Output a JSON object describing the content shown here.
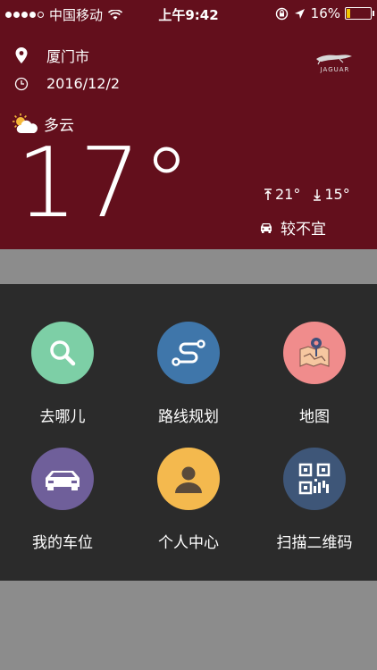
{
  "status": {
    "carrier": "中国移动",
    "time": "上午9:42",
    "battery": "16%",
    "battery_level": 0.16,
    "battery_color": "#f2c700"
  },
  "weather": {
    "city": "厦门市",
    "date": "2016/12/2",
    "brand": "JAGUAR",
    "condition": "多云",
    "temperature": "17°",
    "high": "21°",
    "low": "15°",
    "driving": "较不宜",
    "background": "#630f1c"
  },
  "menu": {
    "items": [
      {
        "label": "去哪儿",
        "icon": "search-icon",
        "color": "#7dcfa6"
      },
      {
        "label": "路线规划",
        "icon": "route-icon",
        "color": "#3f76aa"
      },
      {
        "label": "地图",
        "icon": "map-icon",
        "color": "#f08c8c"
      },
      {
        "label": "我的车位",
        "icon": "car-icon",
        "color": "#6f5f9a"
      },
      {
        "label": "个人中心",
        "icon": "person-icon",
        "color": "#f4b94e"
      },
      {
        "label": "扫描二维码",
        "icon": "qr-code-icon",
        "color": "#3e5678"
      }
    ]
  }
}
